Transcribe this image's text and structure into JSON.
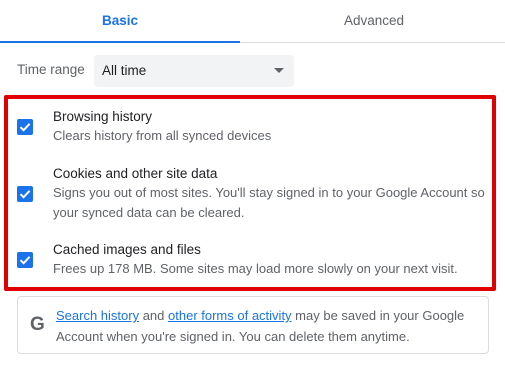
{
  "tabs": {
    "basic": "Basic",
    "advanced": "Advanced",
    "active": "Basic"
  },
  "time_range": {
    "label": "Time range",
    "selected": "All time"
  },
  "items": [
    {
      "title": "Browsing history",
      "description": "Clears history from all synced devices",
      "checked": true
    },
    {
      "title": "Cookies and other site data",
      "description": "Signs you out of most sites. You'll stay signed in to your Google Account so your synced data can be cleared.",
      "checked": true
    },
    {
      "title": "Cached images and files",
      "description": "Frees up 178 MB. Some sites may load more slowly on your next visit.",
      "checked": true
    }
  ],
  "info": {
    "icon": "google-g-icon",
    "link1": "Search history",
    "text1": " and ",
    "link2": "other forms of activity",
    "text2": " may be saved in your Google Account when you're signed in. You can delete them anytime."
  },
  "colors": {
    "accent": "#1a73e8",
    "highlight": "#e00000",
    "text_secondary": "#5f6368"
  }
}
